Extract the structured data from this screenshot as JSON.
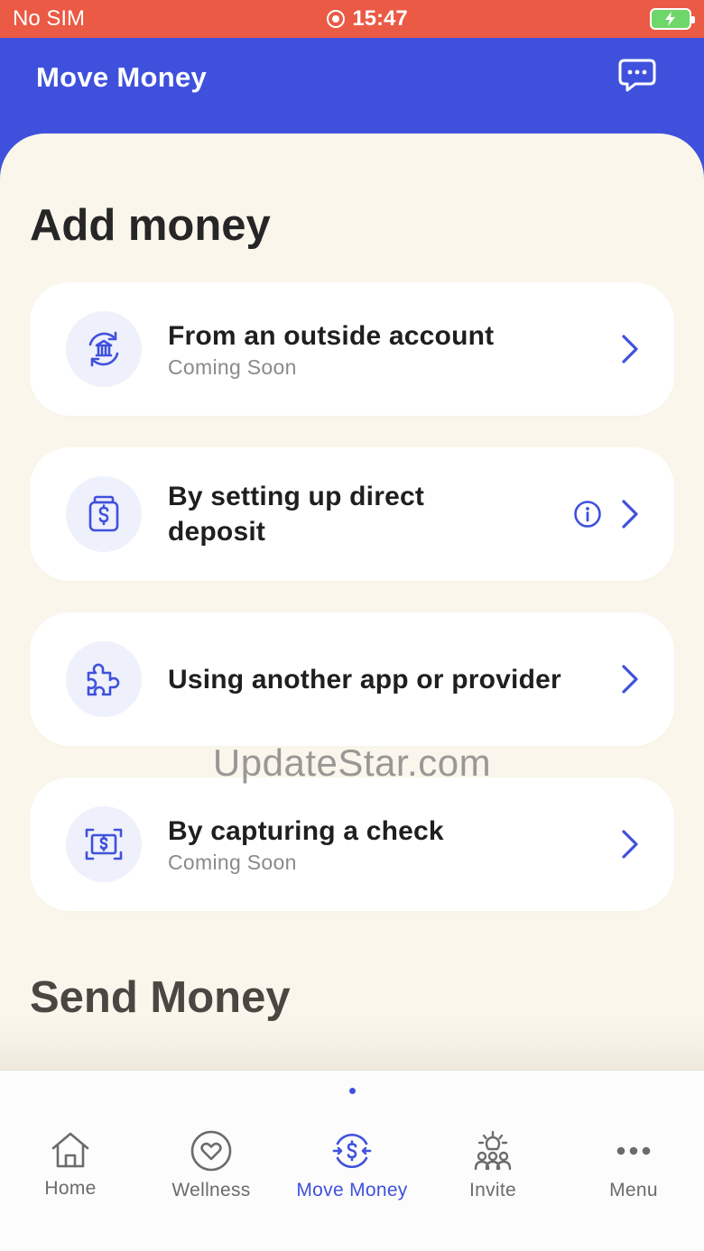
{
  "status_bar": {
    "carrier": "No SIM",
    "time": "15:47"
  },
  "header": {
    "title": "Move Money"
  },
  "add_money": {
    "title": "Add money",
    "items": [
      {
        "title": "From an outside account",
        "subtitle": "Coming Soon",
        "icon": "bank-transfer-icon"
      },
      {
        "title": "By setting up direct deposit",
        "subtitle": "",
        "icon": "deposit-jar-icon"
      },
      {
        "title": "Using another app or provider",
        "subtitle": "",
        "icon": "puzzle-icon"
      },
      {
        "title": "By capturing a check",
        "subtitle": "Coming Soon",
        "icon": "check-scan-icon"
      }
    ]
  },
  "send_money": {
    "title": "Send Money"
  },
  "watermark": "UpdateStar.com",
  "tabs": [
    {
      "label": "Home",
      "icon": "home-icon"
    },
    {
      "label": "Wellness",
      "icon": "heart-icon"
    },
    {
      "label": "Move Money",
      "icon": "move-money-icon",
      "active": true
    },
    {
      "label": "Invite",
      "icon": "invite-icon"
    },
    {
      "label": "Menu",
      "icon": "more-icon"
    }
  ],
  "colors": {
    "brand": "#3f51dc",
    "status_bar": "#ea5a45",
    "sheet_bg": "#faf6ec",
    "icon_bg": "#eef0fb"
  }
}
